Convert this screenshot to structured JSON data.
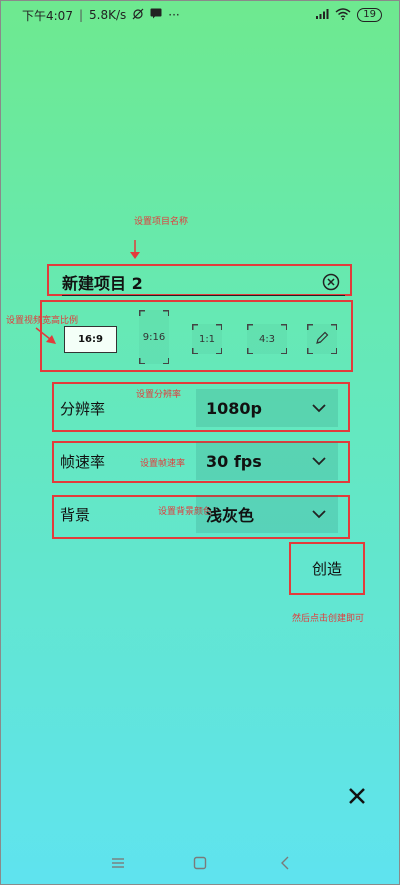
{
  "status_bar": {
    "time": "下午4:07",
    "speed": "5.8K/s",
    "more": "···",
    "battery": "19"
  },
  "annotations": {
    "set_name": "设置项目名称",
    "set_ratio": "设置视频宽高比例",
    "set_resolution": "设置分辨率",
    "set_framerate": "设置帧速率",
    "set_background": "设置背景颜色",
    "then_create": "然后点击创建即可"
  },
  "project": {
    "name": "新建项目 2"
  },
  "aspect_ratios": [
    {
      "label": "16:9",
      "selected": true
    },
    {
      "label": "9:16",
      "selected": false
    },
    {
      "label": "1:1",
      "selected": false
    },
    {
      "label": "4:3",
      "selected": false
    }
  ],
  "settings": {
    "resolution": {
      "label": "分辨率",
      "value": "1080p"
    },
    "framerate": {
      "label": "帧速率",
      "value": "30 fps"
    },
    "background": {
      "label": "背景",
      "value": "浅灰色"
    }
  },
  "buttons": {
    "create": "创造"
  },
  "colors": {
    "annotation": "#e23b3b",
    "gradient_top": "#6ee98f",
    "gradient_bottom": "#5fe3ef"
  },
  "icons": {
    "clear": "circle-x-icon",
    "edit": "pencil-icon",
    "close": "close-icon",
    "nav_menu": "menu-icon",
    "nav_home": "home-icon",
    "nav_back": "back-icon"
  }
}
